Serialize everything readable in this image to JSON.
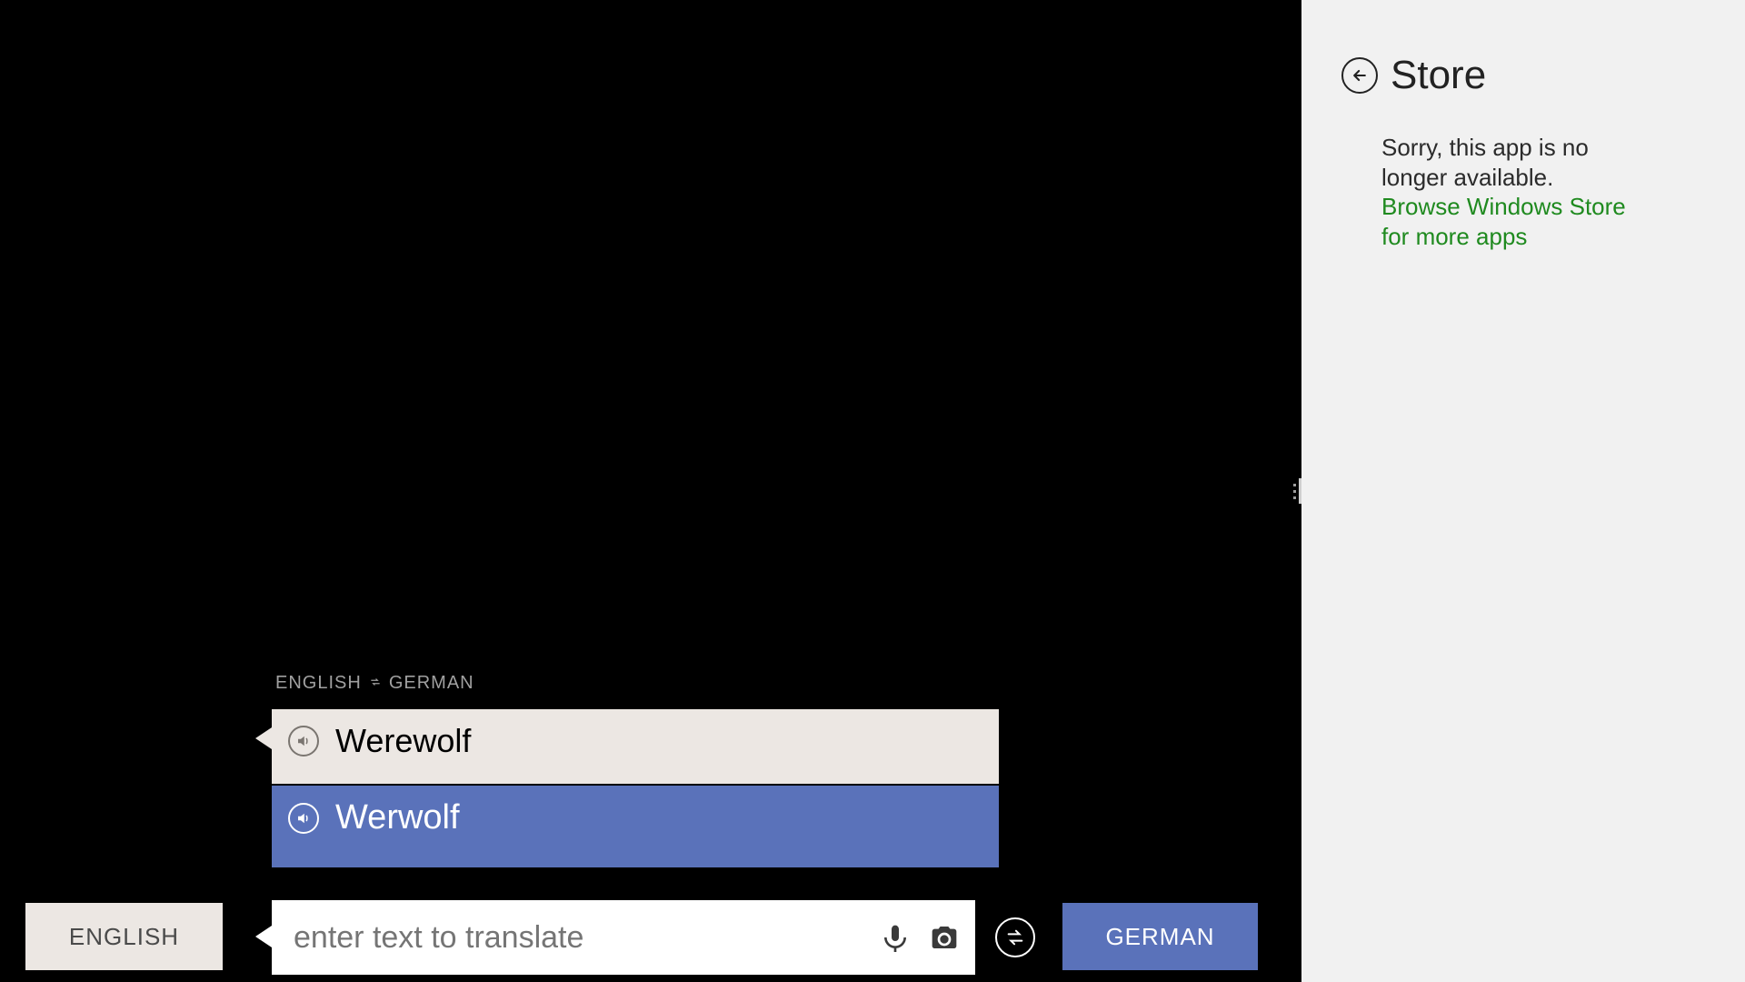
{
  "translator": {
    "pair": {
      "src": "ENGLISH",
      "tgt": "GERMAN"
    },
    "history": {
      "source_text": "Werewolf",
      "target_text": "Werwolf"
    },
    "input": {
      "placeholder": "enter text to translate",
      "value": ""
    },
    "buttons": {
      "source_lang": "ENGLISH",
      "target_lang": "GERMAN"
    }
  },
  "store": {
    "title": "Store",
    "message": "Sorry, this app is no longer available. ",
    "link_text": "Browse Windows Store for more apps"
  },
  "colors": {
    "accent_blue": "#5a72ba",
    "bubble_gray": "#ece7e3",
    "store_bg": "#f1f1f1",
    "link_green": "#1f8a1f"
  }
}
